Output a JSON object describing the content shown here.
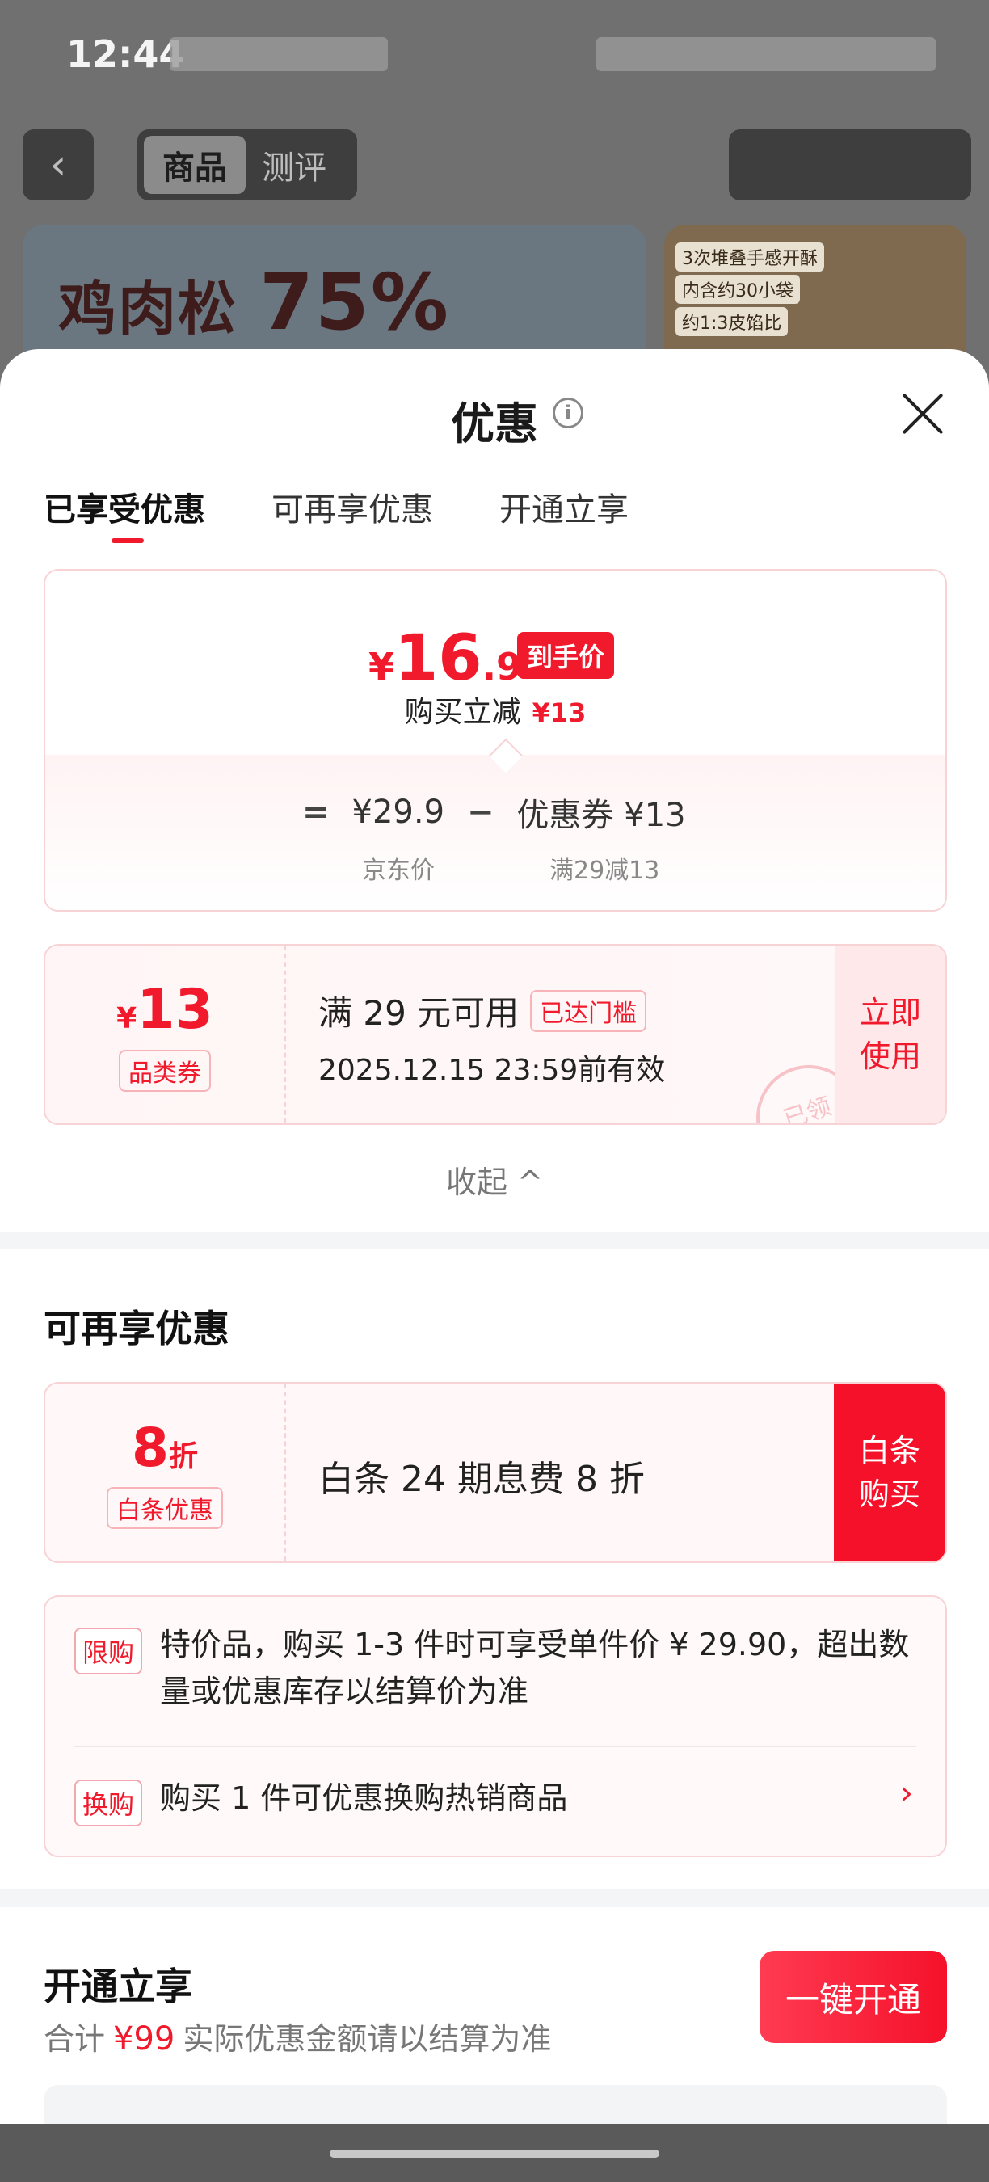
{
  "status": {
    "time": "12:44"
  },
  "header": {
    "tabs": [
      "商品",
      "测评"
    ]
  },
  "banner": {
    "headline": "鸡肉松",
    "percent": "75%",
    "tags": [
      "3次堆叠手感开酥",
      "内含约30小袋",
      "约1:3皮馅比"
    ]
  },
  "sheet": {
    "title": "优惠",
    "tabs": [
      "已享受优惠",
      "可再享优惠",
      "开通立享"
    ],
    "price": {
      "currency": "¥",
      "integer": "16",
      "decimal": ".9",
      "tag": "到手价",
      "reduce_label": "购买立减",
      "reduce_value": "¥13",
      "eq": "=",
      "base_price": "¥29.9",
      "minus": "−",
      "coupon_part": "优惠券 ¥13",
      "base_label": "京东价",
      "coupon_label": "满29减13"
    },
    "coupon": {
      "currency": "¥",
      "amount": "13",
      "type": "品类券",
      "condition": "满 29 元可用",
      "badge": "已达门槛",
      "validity": "2025.12.15 23:59前有效",
      "action_line1": "立即",
      "action_line2": "使用",
      "stamp": "已领"
    },
    "collapse_label": "收起 ^"
  },
  "more": {
    "title": "可再享优惠",
    "baitiao": {
      "discount": "8",
      "unit": "折",
      "type": "白条优惠",
      "text": "白条 24 期息费 8 折",
      "action_line1": "白条",
      "action_line2": "购买"
    },
    "notes": [
      {
        "tag": "限购",
        "text": "特价品，购买 1-3 件时可享受单件价 ¥ 29.90，超出数量或优惠库存以结算价为准"
      },
      {
        "tag": "换购",
        "text": "购买 1 件可优惠换购热销商品",
        "chevron": "›"
      }
    ]
  },
  "membership": {
    "title": "开通立享",
    "sub_prefix": "合计",
    "sub_amount": "¥99",
    "sub_suffix": "实际优惠金额请以结算为准",
    "button": "一键开通"
  },
  "colors": {
    "accent": "#f01a2c",
    "card_border": "#f7d3d6",
    "card_bg": "#fff7f8"
  },
  "icons": {
    "back": "chevron-left-icon",
    "info": "info-icon",
    "close": "close-icon",
    "collapse": "chevron-up-icon",
    "more": "chevron-right-icon"
  }
}
